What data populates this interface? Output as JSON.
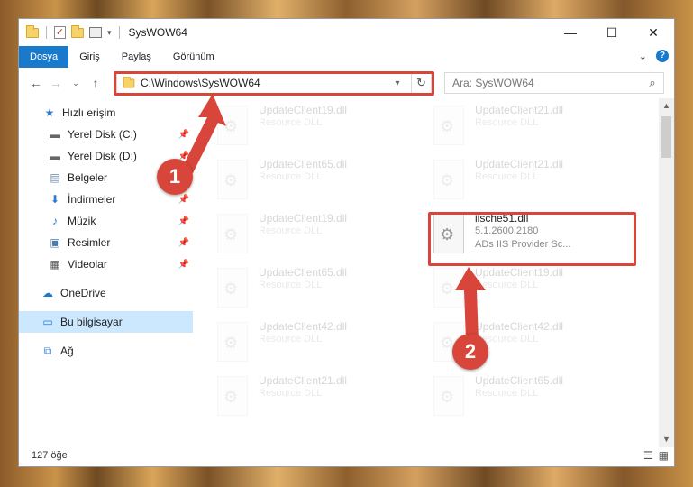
{
  "window": {
    "title": "SysWOW64",
    "controls": {
      "minimize": "—",
      "maximize": "☐",
      "close": "✕"
    }
  },
  "ribbon": {
    "tabs": [
      "Dosya",
      "Giriş",
      "Paylaş",
      "Görünüm"
    ],
    "expand_label": "⌄",
    "help_label": "?"
  },
  "nav": {
    "back": "←",
    "forward": "→",
    "recent": "⌄",
    "up": "↑",
    "address": "C:\\Windows\\SysWOW64",
    "search_placeholder": "Ara: SysWOW64"
  },
  "sidebar": {
    "items": [
      {
        "label": "Hızlı erişim",
        "icon": "star-icon",
        "pinned": false
      },
      {
        "label": "Yerel Disk (C:)",
        "icon": "drive-icon",
        "pinned": true
      },
      {
        "label": "Yerel Disk (D:)",
        "icon": "drive-icon",
        "pinned": true
      },
      {
        "label": "Belgeler",
        "icon": "document-icon",
        "pinned": true
      },
      {
        "label": "İndirmeler",
        "icon": "download-icon",
        "pinned": true
      },
      {
        "label": "Müzik",
        "icon": "music-icon",
        "pinned": true
      },
      {
        "label": "Resimler",
        "icon": "picture-icon",
        "pinned": true
      },
      {
        "label": "Videolar",
        "icon": "video-icon",
        "pinned": true
      },
      {
        "label": "OneDrive",
        "icon": "cloud-icon",
        "pinned": false
      },
      {
        "label": "Bu bilgisayar",
        "icon": "computer-icon",
        "pinned": false,
        "selected": true
      },
      {
        "label": "Ağ",
        "icon": "network-icon",
        "pinned": false
      }
    ]
  },
  "files": [
    {
      "name": "UpdateClient19.dll",
      "type": "Resource DLL"
    },
    {
      "name": "UpdateClient21.dll",
      "type": "Resource DLL"
    },
    {
      "name": "UpdateClient65.dll",
      "type": "Resource DLL"
    },
    {
      "name": "UpdateClient21.dll",
      "type": "Resource DLL"
    },
    {
      "name": "UpdateClient19.dll",
      "type": "Resource DLL"
    },
    {
      "name": "iische51.dll",
      "version": "5.1.2600.2180",
      "type": "ADs IIS Provider Sc..."
    },
    {
      "name": "UpdateClient65.dll",
      "type": "Resource DLL"
    },
    {
      "name": "UpdateClient19.dll",
      "type": "Resource DLL"
    },
    {
      "name": "UpdateClient42.dll",
      "type": "Resource DLL"
    },
    {
      "name": "UpdateClient42.dll",
      "type": "Resource DLL"
    },
    {
      "name": "UpdateClient21.dll",
      "type": "Resource DLL"
    },
    {
      "name": "UpdateClient65.dll",
      "type": "Resource DLL"
    }
  ],
  "status": {
    "item_count": "127 öğe"
  },
  "annotations": {
    "step1": "1",
    "step2": "2"
  },
  "colors": {
    "accent": "#1979ca",
    "highlight": "#d8453b",
    "selected_nav": "#cce8ff"
  }
}
